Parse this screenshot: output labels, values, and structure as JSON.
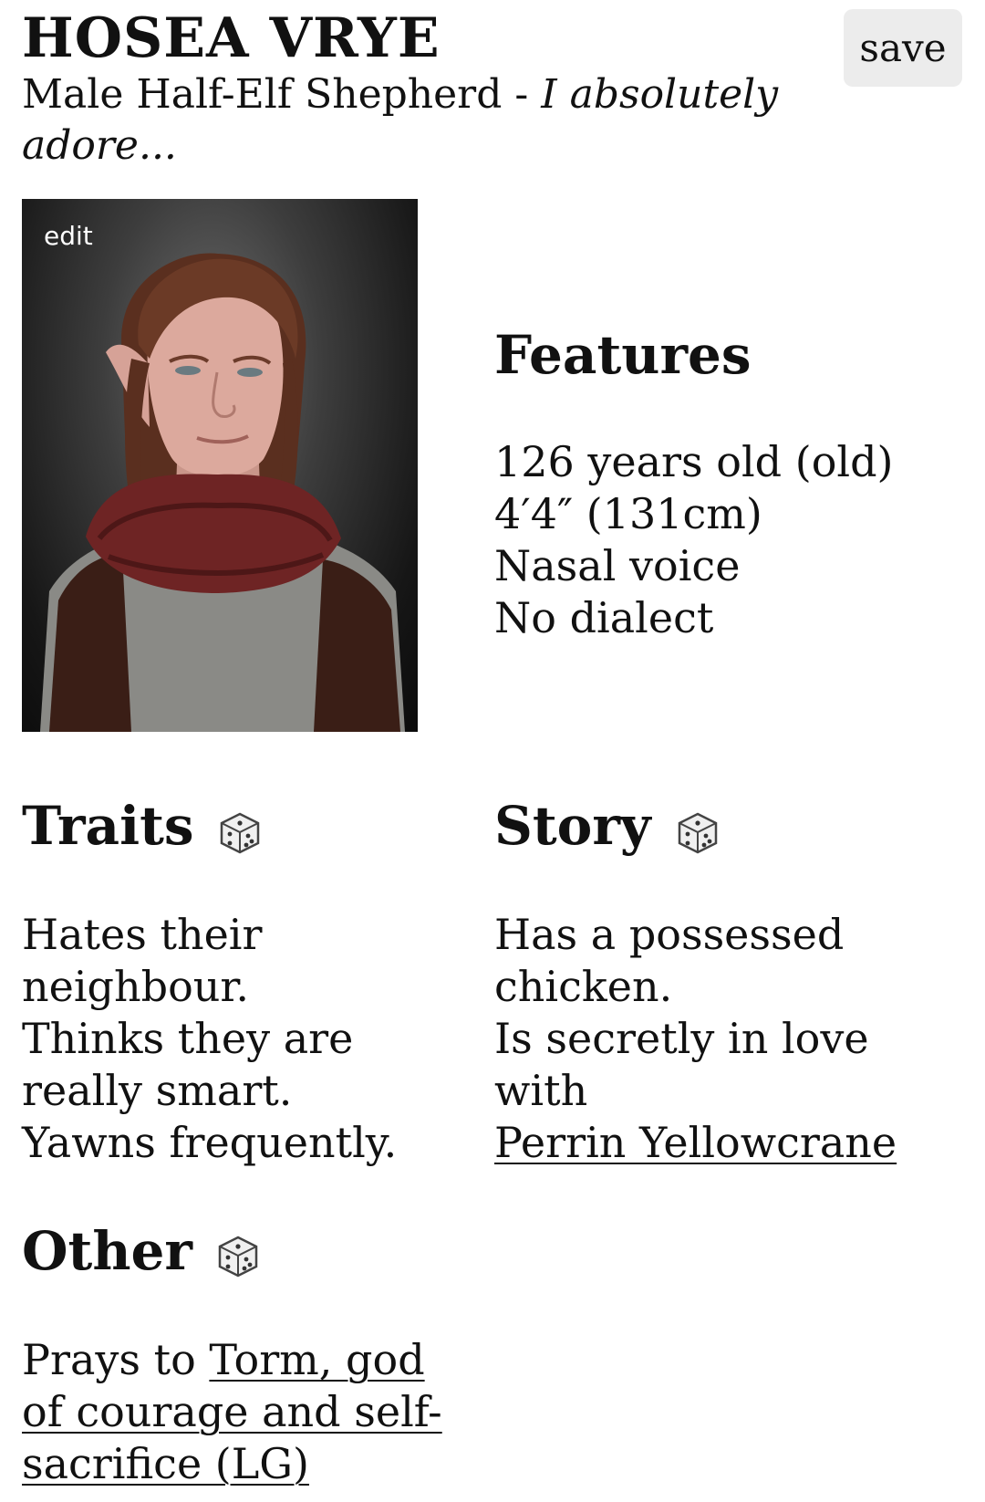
{
  "header": {
    "name": "HOSEA VRYE",
    "subtitle_plain": "Male Half-Elf Shepherd - ",
    "subtitle_italic": "I absolutely adore...",
    "save_label": "save"
  },
  "portrait": {
    "edit_label": "edit",
    "alt": "portrait-image"
  },
  "features": {
    "title": "Features",
    "items": [
      "126 years old (old)",
      "4′4″ (131cm)",
      "Nasal voice",
      "No dialect"
    ]
  },
  "traits": {
    "title": "Traits",
    "dice_icon": "dice-icon",
    "items": [
      "Hates their neighbour.",
      "Thinks they are really smart.",
      "Yawns frequently."
    ]
  },
  "story": {
    "title": "Story",
    "dice_icon": "dice-icon",
    "item1": "Has a possessed chicken.",
    "item2_text": "Is secretly in love with",
    "item2_link": "Perrin Yellowcrane"
  },
  "other": {
    "title": "Other",
    "dice_icon": "dice-icon",
    "prefix": "Prays to ",
    "link": "Torm, god of courage and self-sacrifice (LG)"
  }
}
